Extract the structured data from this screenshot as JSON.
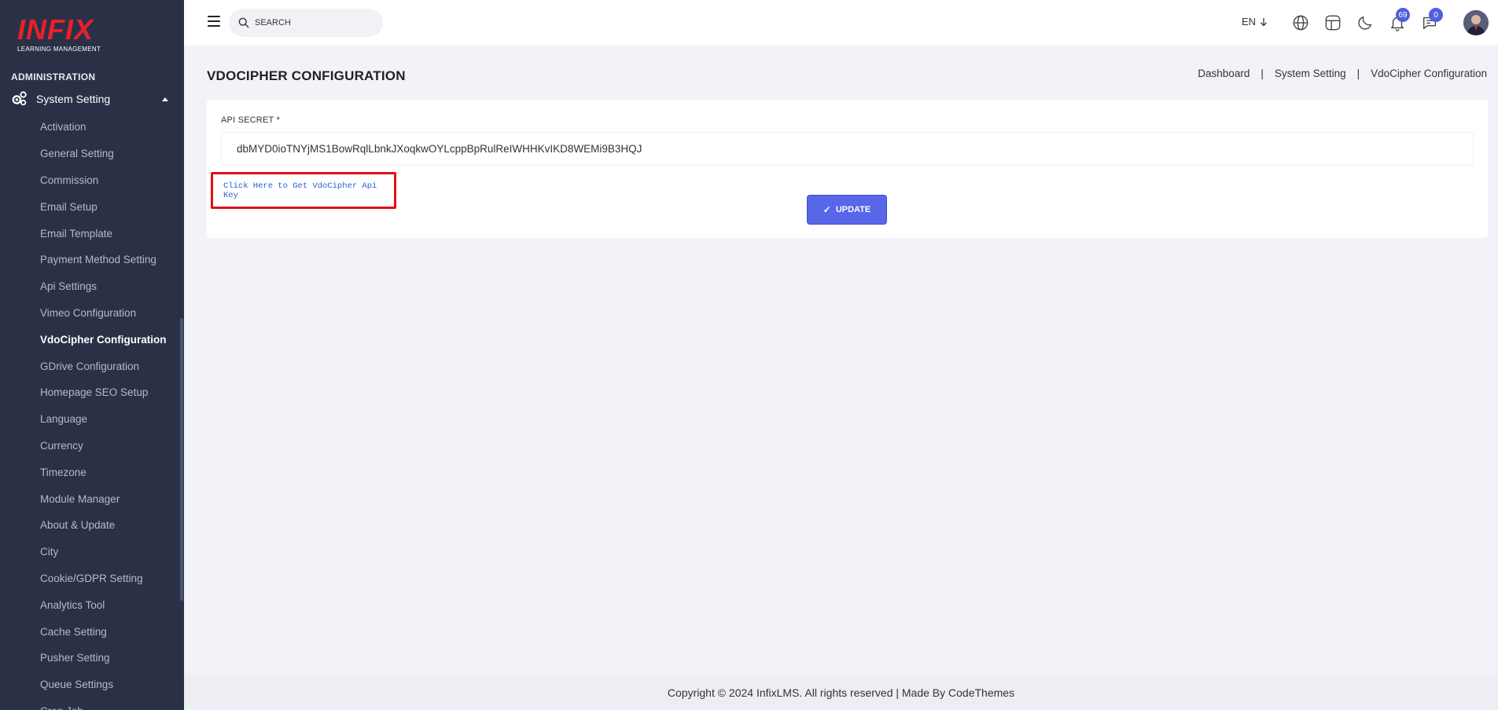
{
  "brand": {
    "logo_text": "INFIX",
    "logo_subtitle": "LEARNING MANAGEMENT"
  },
  "sidebar": {
    "section_heading": "ADMINISTRATION",
    "group_label": "System Setting",
    "items": [
      {
        "label": "Activation"
      },
      {
        "label": "General Setting"
      },
      {
        "label": "Commission"
      },
      {
        "label": "Email Setup"
      },
      {
        "label": "Email Template"
      },
      {
        "label": "Payment Method Setting"
      },
      {
        "label": "Api Settings"
      },
      {
        "label": "Vimeo Configuration"
      },
      {
        "label": "VdoCipher Configuration"
      },
      {
        "label": "GDrive Configuration"
      },
      {
        "label": "Homepage SEO Setup"
      },
      {
        "label": "Language"
      },
      {
        "label": "Currency"
      },
      {
        "label": "Timezone"
      },
      {
        "label": "Module Manager"
      },
      {
        "label": "About & Update"
      },
      {
        "label": "City"
      },
      {
        "label": "Cookie/GDPR Setting"
      },
      {
        "label": "Analytics Tool"
      },
      {
        "label": "Cache Setting"
      },
      {
        "label": "Pusher Setting"
      },
      {
        "label": "Queue Settings"
      },
      {
        "label": "Cron Job"
      }
    ],
    "active_item": "VdoCipher Configuration"
  },
  "header": {
    "search_placeholder": "SEARCH",
    "language": "EN",
    "notification_count": "69",
    "message_count": "0",
    "icons": [
      "menu-icon",
      "search-icon",
      "globe-icon",
      "layout-icon",
      "moon-icon",
      "bell-icon",
      "chat-icon",
      "avatar"
    ]
  },
  "page": {
    "title": "VDOCIPHER CONFIGURATION",
    "breadcrumb": [
      "Dashboard",
      "System Setting",
      "VdoCipher Configuration"
    ]
  },
  "form": {
    "api_secret_label": "API SECRET *",
    "api_secret_value": "dbMYD0ioTNYjMS1BowRqlLbnkJXoqkwOYLcppBpRulReIWHHKvIKD8WEMi9B3HQJ",
    "api_key_link": "Click Here to Get VdoCipher Api Key",
    "update_label": "UPDATE"
  },
  "footer": {
    "copyright": "Copyright © 2024 InfixLMS. All rights reserved | Made By CodeThemes"
  },
  "colors": {
    "sidebar_bg": "#2a3147",
    "accent": "#5866e8",
    "logo_red": "#e8202a",
    "highlight_border": "#e0101a",
    "link_blue": "#2563d0",
    "badge": "#4f5fe0"
  }
}
